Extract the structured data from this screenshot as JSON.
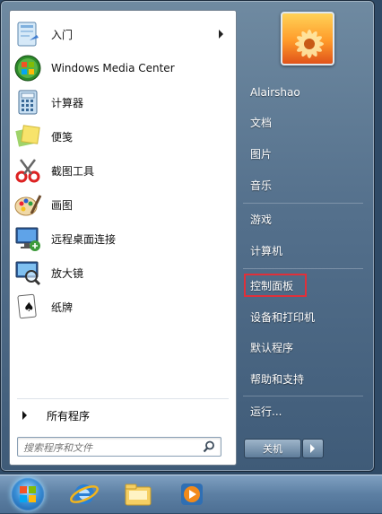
{
  "left_items": [
    {
      "label": "入门",
      "icon": "getting-started-icon",
      "arrow": true
    },
    {
      "label": "Windows Media Center",
      "icon": "windows-media-center-icon"
    },
    {
      "label": "计算器",
      "icon": "calculator-icon"
    },
    {
      "label": "便笺",
      "icon": "sticky-notes-icon"
    },
    {
      "label": "截图工具",
      "icon": "snipping-tool-icon"
    },
    {
      "label": "画图",
      "icon": "paint-icon"
    },
    {
      "label": "远程桌面连接",
      "icon": "remote-desktop-icon"
    },
    {
      "label": "放大镜",
      "icon": "magnifier-icon"
    },
    {
      "label": "纸牌",
      "icon": "solitaire-icon"
    }
  ],
  "all_programs_label": "所有程序",
  "search": {
    "placeholder": "搜索程序和文件",
    "icon": "search-icon"
  },
  "right_items": [
    {
      "label": "Alairshao"
    },
    {
      "label": "文档"
    },
    {
      "label": "图片"
    },
    {
      "label": "音乐"
    },
    {
      "label": "游戏"
    },
    {
      "label": "计算机"
    },
    {
      "label": "控制面板",
      "highlighted": true
    },
    {
      "label": "设备和打印机"
    },
    {
      "label": "默认程序"
    },
    {
      "label": "帮助和支持"
    },
    {
      "label": "运行..."
    }
  ],
  "shutdown_label": "关机",
  "taskbar": [
    {
      "icon": "start-orb-icon"
    },
    {
      "icon": "internet-explorer-icon"
    },
    {
      "icon": "windows-explorer-icon"
    },
    {
      "icon": "media-player-icon"
    }
  ],
  "colors": {
    "highlight_border": "#e0303a",
    "menu_blue": "#54708c"
  }
}
